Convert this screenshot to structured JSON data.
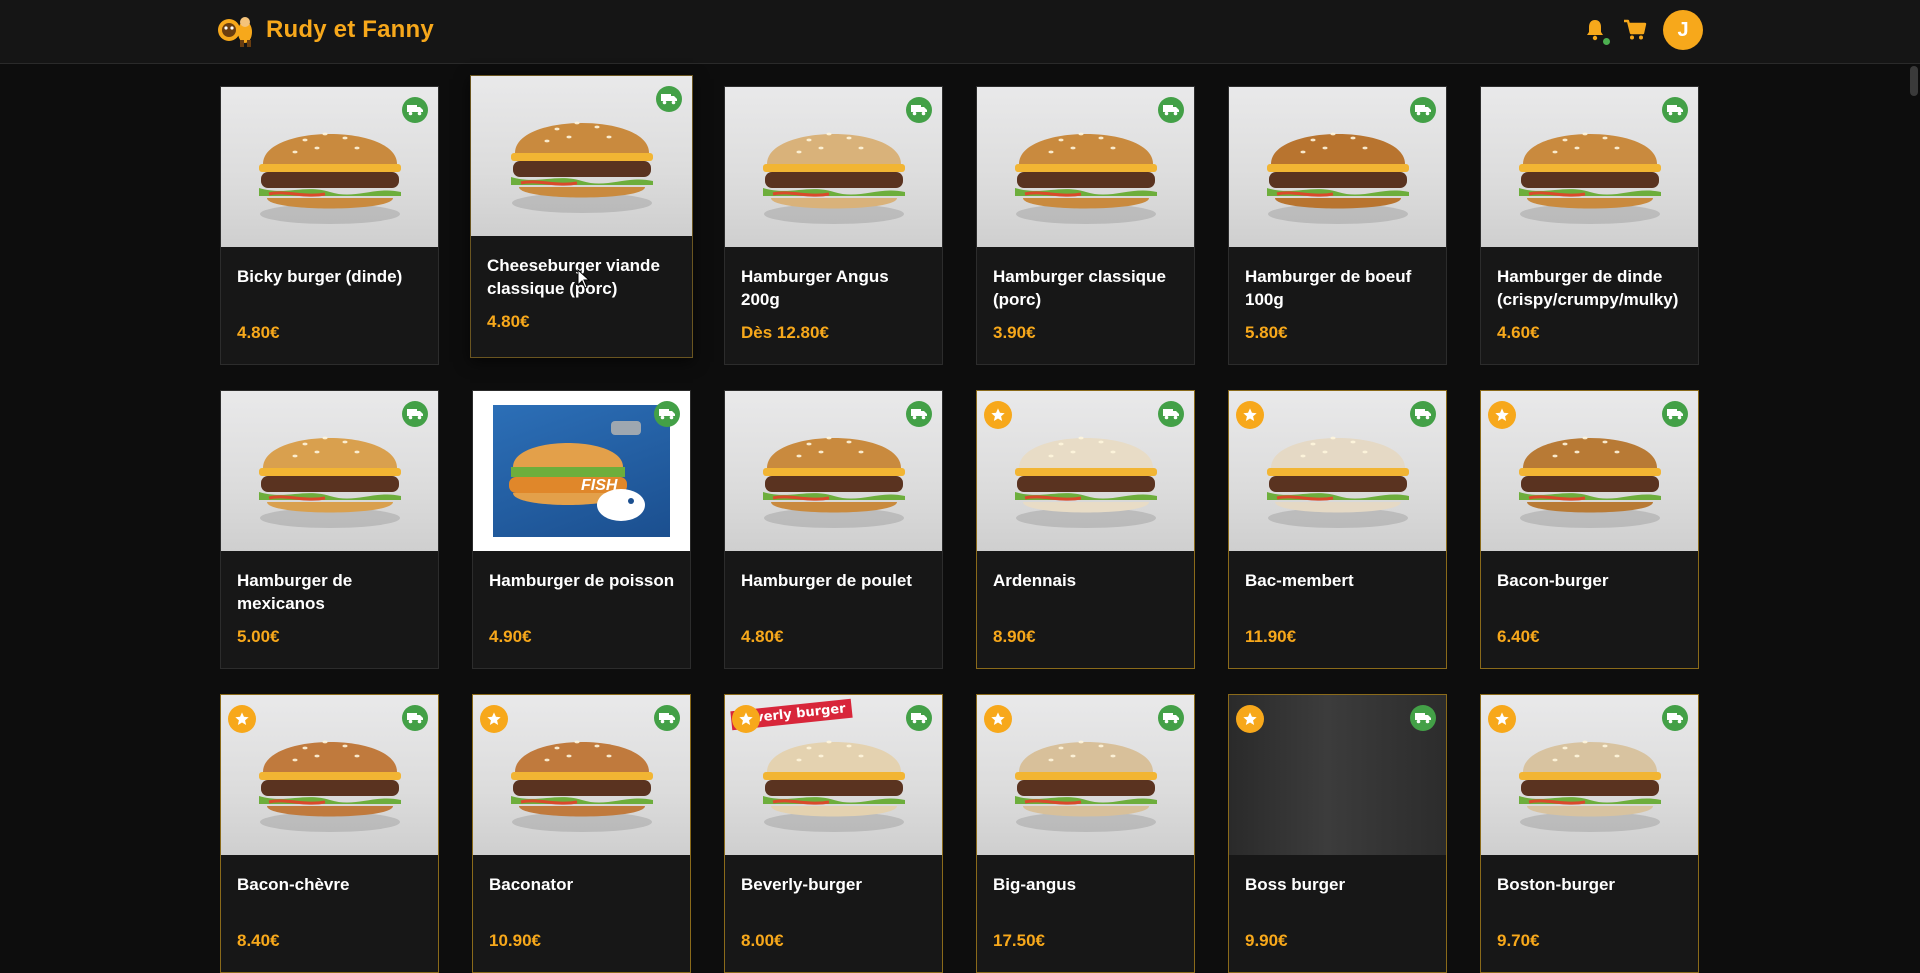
{
  "app": {
    "brand_name": "Rudy et Fanny",
    "avatar_initial": "J",
    "accent_color": "#f7a81b",
    "notification_dot_color": "#4caf50",
    "delivery_badge_color": "#43a047"
  },
  "header_icons": [
    "bell-icon",
    "cart-icon"
  ],
  "products": [
    {
      "name": "Bicky burger (dinde)",
      "price": "4.80€",
      "featured": false,
      "delivery": true
    },
    {
      "name": "Cheeseburger viande classique (porc)",
      "price": "4.80€",
      "featured": false,
      "delivery": true
    },
    {
      "name": "Hamburger Angus 200g",
      "price": "Dès 12.80€",
      "featured": false,
      "delivery": true
    },
    {
      "name": "Hamburger classique (porc)",
      "price": "3.90€",
      "featured": false,
      "delivery": true
    },
    {
      "name": "Hamburger de boeuf 100g",
      "price": "5.80€",
      "featured": false,
      "delivery": true
    },
    {
      "name": "Hamburger de dinde (crispy/crumpy/mulky)",
      "price": "4.60€",
      "featured": false,
      "delivery": true
    },
    {
      "name": "Hamburger de mexicanos",
      "price": "5.00€",
      "featured": false,
      "delivery": true
    },
    {
      "name": "Hamburger de poisson",
      "price": "4.90€",
      "featured": false,
      "delivery": true,
      "image_text": "FISH"
    },
    {
      "name": "Hamburger de poulet",
      "price": "4.80€",
      "featured": false,
      "delivery": true
    },
    {
      "name": "Ardennais",
      "price": "8.90€",
      "featured": true,
      "delivery": true
    },
    {
      "name": "Bac-membert",
      "price": "11.90€",
      "featured": true,
      "delivery": true
    },
    {
      "name": "Bacon-burger",
      "price": "6.40€",
      "featured": true,
      "delivery": true
    },
    {
      "name": "Bacon-chèvre",
      "price": "8.40€",
      "featured": true,
      "delivery": true
    },
    {
      "name": "Baconator",
      "price": "10.90€",
      "featured": true,
      "delivery": true
    },
    {
      "name": "Beverly-burger",
      "price": "8.00€",
      "featured": true,
      "delivery": true,
      "image_text": "beverly burger"
    },
    {
      "name": "Big-angus",
      "price": "17.50€",
      "featured": true,
      "delivery": true
    },
    {
      "name": "Boss burger",
      "price": "9.90€",
      "featured": true,
      "delivery": true
    },
    {
      "name": "Boston-burger",
      "price": "9.70€",
      "featured": true,
      "delivery": true
    }
  ]
}
